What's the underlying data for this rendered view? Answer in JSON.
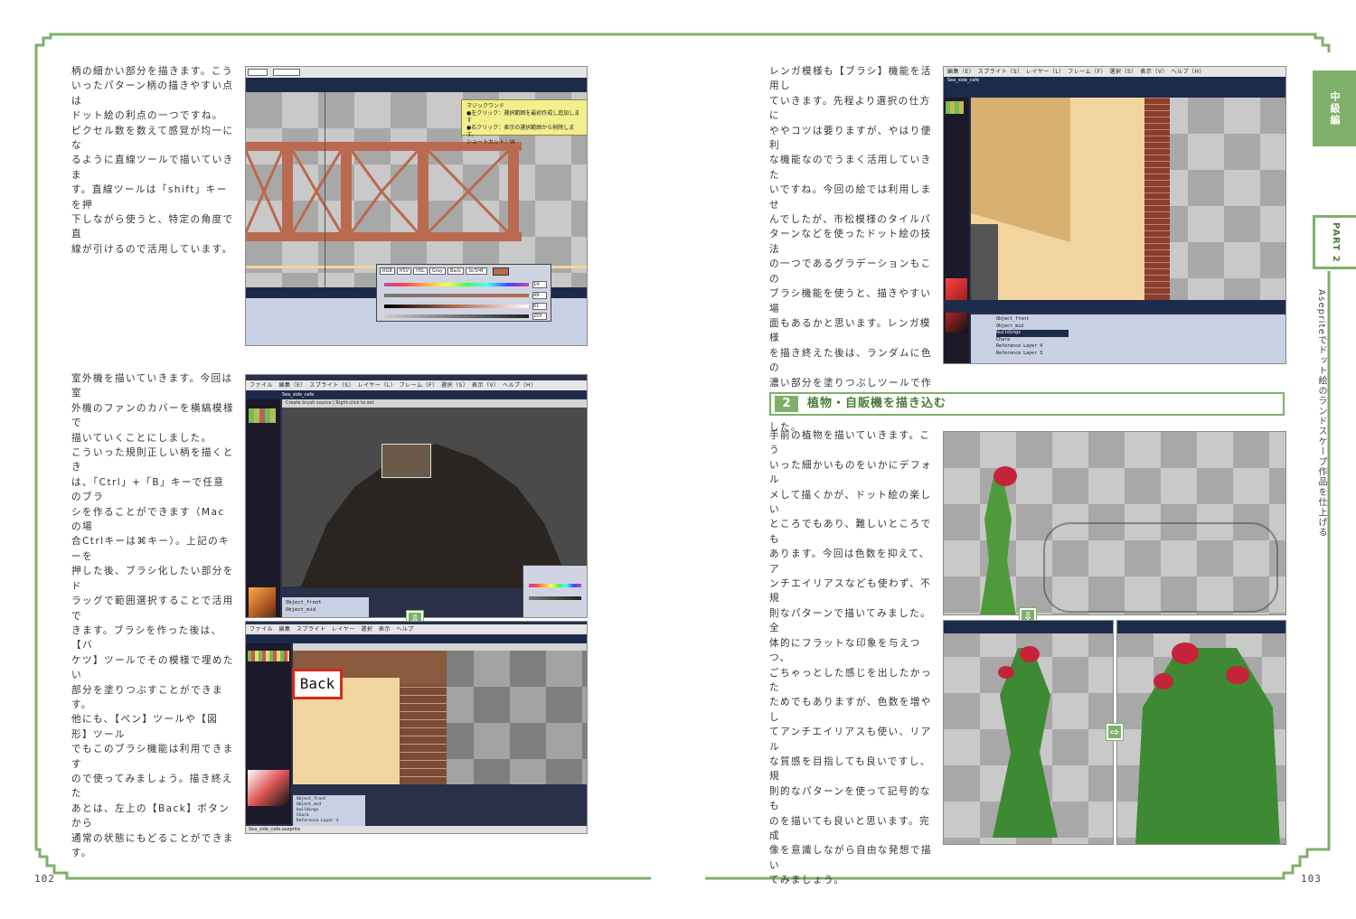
{
  "left_page": {
    "page_number": "102",
    "para1": "柄の細かい部分を描きます。こう\nいったパターン柄の描きやすい点は\nドット絵の利点の一つですね。\nピクセル数を数えて感覚が均一にな\nるように直線ツールで描いていきま\nす。直線ツールは「shift」キーを押\n下しながら使うと、特定の角度で直\n線が引けるので活用しています。",
    "para2": "室外機を描いていきます。今回は室\n外機のファンのカバーを横縞模様で\n描いていくことにしました。\nこういった規則正しい柄を描くとき\nは、「Ctrl」+「B」キーで任意のブラ\nシを作ることができます（Macの場\n合Ctrlキーは⌘キー）。上記のキーを\n押した後、ブラシ化したい部分をド\nラッグで範囲選択することで活用で\nきます。ブラシを作った後は、【バ\nケツ】ツールでその模様で埋めたい\n部分を塗りつぶすことができます。\n他にも、【ペン】ツールや【図形】ツール\nでもこのブラシ機能は利用できます\nので使ってみましょう。描き終えた\nあとは、左上の【Back】ボタンから\n通常の状態にもどることができます。",
    "tooltip_lines": [
      "マジックワンド",
      "●左クリック：選択範囲を最初作成し追加します",
      "●右クリック：表示の選択範囲から削除します。",
      "ショートカット：W"
    ],
    "color_tabs": [
      "RGB",
      "HSV",
      "HSL",
      "Gray",
      "Back"
    ],
    "color_hex": "bc5f4f",
    "color_values": [
      "14",
      "49",
      "61",
      "255"
    ],
    "menu2": "ファイル　編集（E）　スプライト（S）　レイヤー（L）　フレーム（F）　選択（S）　表示（V）　ヘルプ（H）",
    "file_tab": "Sea_side_cafe",
    "brush_hint": "Create brush source | Right-click to set",
    "layers2": [
      "Object_front",
      "Object_mid"
    ],
    "back_label": "Back",
    "menu3": "ファイル　編集　スプライト　レイヤー　選択　表示　ヘルプ",
    "layers3": [
      "Object_front",
      "Object_mid",
      "buildings",
      "Chara",
      "Reference Layer 4"
    ],
    "status3": "Sea_side_cafe.aseprite"
  },
  "right_page": {
    "page_number": "103",
    "para1": "レンガ模様も【ブラシ】機能を活用し\nていきます。先程より選択の仕方に\nややコツは要りますが、やはり便利\nな機能なのでうまく活用していきた\nいですね。今回の絵では利用しませ\nんでしたが、市松模様のタイルパ\nターンなどを使ったドット絵の技法\nの一つであるグラデーションもこの\nブラシ機能を使うと、描きやすい場\n面もあるかと思います。レンガ模様\nを描き終えた後は、ランダムに色の\n濃い部分を塗りつぶしツールで作\nり、よりレンガっぽさを出してみま\nした。",
    "section_number": "2",
    "section_title": "植物・自販機を描き込む",
    "para2": "手前の植物を描いていきます。こう\nいった細かいものをいかにデフォル\nメして描くかが、ドット絵の楽しい\nところでもあり、難しいところでも\nあります。今回は色数を抑えて、ア\nンチエイリアスなども使わず、不規\n則なパターンで描いてみました。全\n体的にフラットな印象を与えつつ、\nごちゃっとした感じを出したかった\nためでもありますが、色数を増やし\nてアンチエイリアスも使い、リアル\nな質感を目指しても良いですし、規\n則的なパターンを使って記号的なも\nのを描いても良いと思います。完成\n像を意識しながら自由な発想で描い\nてみましょう。",
    "menu": "編集（E）　スプライト（S）　レイヤー（L）　フレーム（F）　選択（S）　表示（V）　ヘルプ（H）",
    "file_tab": "Sea_side_cafe",
    "layers": [
      "Object_front",
      "Object_mid",
      "buildings",
      "Chara",
      "Reference Layer 4",
      "Reference Layer 3"
    ]
  },
  "side_tabs": {
    "level": "中級編",
    "part": "PART 2",
    "caption": "Asepriteでドット絵のランドスケープ作品を仕上げる"
  },
  "colors": {
    "accent_green": "#7fb069",
    "brick": "#b96a4f",
    "ui_dark": "#1d2b4a"
  }
}
